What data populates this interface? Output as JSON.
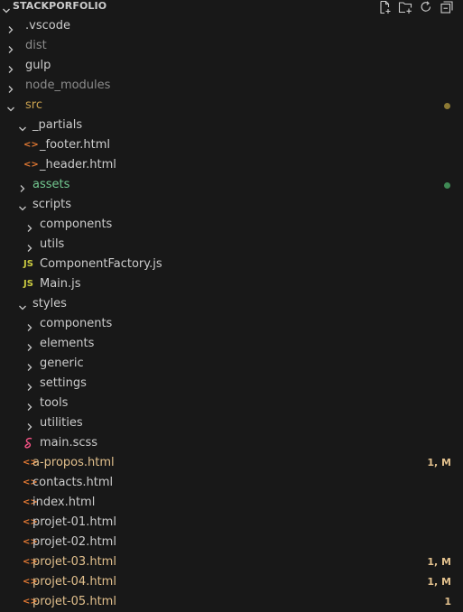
{
  "explorer": {
    "title": "STACKPORFOLIO"
  },
  "colors": {
    "background": "#181818",
    "default_text": "#cccccc",
    "ignored_text": "#8c8c8c",
    "modified": "#e2c08d",
    "untracked": "#73c991",
    "src_folder": "#c9a14f",
    "html_icon": "#e37933",
    "js_icon": "#cbcb41",
    "scss_icon": "#f55385"
  },
  "tree": [
    {
      "label": ".vscode",
      "kind": "folder",
      "expanded": false,
      "depth": 0,
      "status": "default"
    },
    {
      "label": "dist",
      "kind": "folder",
      "expanded": false,
      "depth": 0,
      "status": "ignored"
    },
    {
      "label": "gulp",
      "kind": "folder",
      "expanded": false,
      "depth": 0,
      "status": "default"
    },
    {
      "label": "node_modules",
      "kind": "folder",
      "expanded": false,
      "depth": 0,
      "status": "ignored"
    },
    {
      "label": "src",
      "kind": "folder",
      "expanded": true,
      "depth": 0,
      "status": "src",
      "dot": "modified"
    },
    {
      "label": "_partials",
      "kind": "folder",
      "expanded": true,
      "depth": 1,
      "status": "default"
    },
    {
      "label": "_footer.html",
      "kind": "html",
      "depth": 2,
      "status": "default"
    },
    {
      "label": "_header.html",
      "kind": "html",
      "depth": 2,
      "status": "default"
    },
    {
      "label": "assets",
      "kind": "folder",
      "expanded": false,
      "depth": 1,
      "status": "untracked",
      "dot": "untracked"
    },
    {
      "label": "scripts",
      "kind": "folder",
      "expanded": true,
      "depth": 1,
      "status": "default"
    },
    {
      "label": "components",
      "kind": "folder",
      "expanded": false,
      "depth": 2,
      "status": "default"
    },
    {
      "label": "utils",
      "kind": "folder",
      "expanded": false,
      "depth": 2,
      "status": "default"
    },
    {
      "label": "ComponentFactory.js",
      "kind": "js",
      "depth": 2,
      "status": "default"
    },
    {
      "label": "Main.js",
      "kind": "js",
      "depth": 2,
      "status": "default"
    },
    {
      "label": "styles",
      "kind": "folder",
      "expanded": true,
      "depth": 1,
      "status": "default"
    },
    {
      "label": "components",
      "kind": "folder",
      "expanded": false,
      "depth": 2,
      "status": "default"
    },
    {
      "label": "elements",
      "kind": "folder",
      "expanded": false,
      "depth": 2,
      "status": "default"
    },
    {
      "label": "generic",
      "kind": "folder",
      "expanded": false,
      "depth": 2,
      "status": "default"
    },
    {
      "label": "settings",
      "kind": "folder",
      "expanded": false,
      "depth": 2,
      "status": "default"
    },
    {
      "label": "tools",
      "kind": "folder",
      "expanded": false,
      "depth": 2,
      "status": "default"
    },
    {
      "label": "utilities",
      "kind": "folder",
      "expanded": false,
      "depth": 2,
      "status": "default"
    },
    {
      "label": "main.scss",
      "kind": "scss",
      "depth": 2,
      "status": "default"
    },
    {
      "label": "a-propos.html",
      "kind": "html",
      "depth": 1,
      "status": "modified",
      "badge": "1, M"
    },
    {
      "label": "contacts.html",
      "kind": "html",
      "depth": 1,
      "status": "default"
    },
    {
      "label": "index.html",
      "kind": "html",
      "depth": 1,
      "status": "default"
    },
    {
      "label": "projet-01.html",
      "kind": "html",
      "depth": 1,
      "status": "default"
    },
    {
      "label": "projet-02.html",
      "kind": "html",
      "depth": 1,
      "status": "default"
    },
    {
      "label": "projet-03.html",
      "kind": "html",
      "depth": 1,
      "status": "modified",
      "badge": "1, M"
    },
    {
      "label": "projet-04.html",
      "kind": "html",
      "depth": 1,
      "status": "modified",
      "badge": "1, M"
    },
    {
      "label": "projet-05.html",
      "kind": "html",
      "depth": 1,
      "status": "modified",
      "badge": "1"
    }
  ],
  "icons": {
    "title_chevron": "chevron-down-icon",
    "new_file": "new-file-icon",
    "new_folder": "new-folder-icon",
    "refresh": "refresh-icon",
    "collapse_all": "collapse-all-icon",
    "html": "html-file-icon",
    "js": "js-file-icon",
    "scss": "scss-file-icon"
  },
  "glyphs": {
    "html": "<>",
    "js": "JS"
  }
}
